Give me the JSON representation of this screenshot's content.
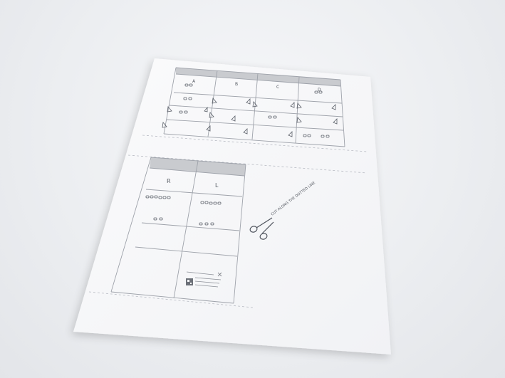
{
  "sheet_top": {
    "headers": [
      "A",
      "B",
      "C",
      "D"
    ]
  },
  "sheet_bottom": {
    "headers": [
      "R",
      "L"
    ]
  },
  "cut_instruction": "CUT ALONG THE DOTTED LINE"
}
